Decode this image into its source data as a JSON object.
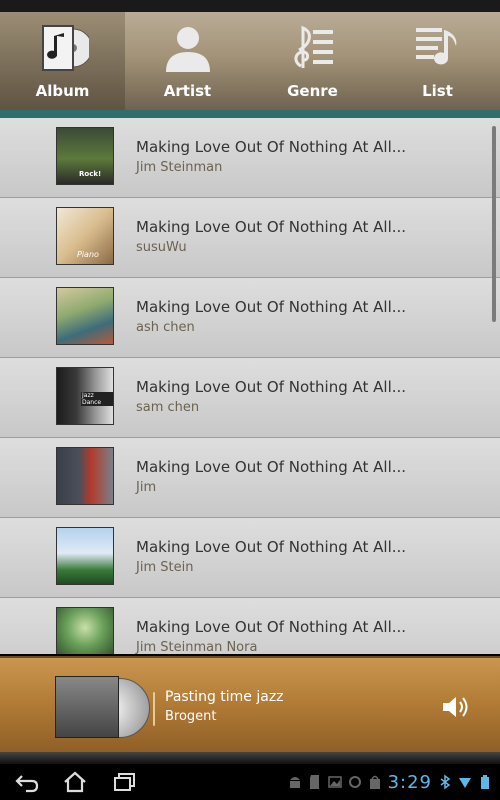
{
  "tabs": [
    {
      "label": "Album",
      "icon": "album-icon",
      "active": true
    },
    {
      "label": "Artist",
      "icon": "artist-icon",
      "active": false
    },
    {
      "label": "Genre",
      "icon": "genre-icon",
      "active": false
    },
    {
      "label": "List",
      "icon": "playlist-icon",
      "active": false
    }
  ],
  "songs": [
    {
      "title": "Making Love Out Of Nothing At All...",
      "artist": "Jim Steinman",
      "thumb_text": "Rock!",
      "colors": [
        "#2d3a2a",
        "#5c7a3a",
        "#a0324a"
      ]
    },
    {
      "title": "Making Love Out Of Nothing At All...",
      "artist": "susuWu",
      "thumb_text": "Piano",
      "colors": [
        "#e8dfc9",
        "#c9a97a",
        "#7a5a3a"
      ]
    },
    {
      "title": "Making Love Out Of Nothing At All...",
      "artist": "ash chen",
      "thumb_text": "",
      "colors": [
        "#c8b98f",
        "#7f9a6a",
        "#3a5a6a"
      ]
    },
    {
      "title": "Making Love Out Of Nothing At All...",
      "artist": "sam chen",
      "thumb_text": "Jazz Dance",
      "colors": [
        "#1c1c1c",
        "#6a6a6a",
        "#dcdcdc"
      ]
    },
    {
      "title": "Making Love Out Of Nothing At All...",
      "artist": "Jim",
      "thumb_text": "",
      "colors": [
        "#3a3f4a",
        "#b23a2a",
        "#7a7f8a"
      ]
    },
    {
      "title": "Making Love Out Of Nothing At All...",
      "artist": "Jim Stein",
      "thumb_text": "",
      "colors": [
        "#a9c9e9",
        "#3a7a3a",
        "#dfeaf5"
      ]
    },
    {
      "title": "Making Love Out Of Nothing At All...",
      "artist": "Jim Steinman Nora",
      "thumb_text": "",
      "colors": [
        "#1f3a1f",
        "#6aa05a",
        "#c9e0a9"
      ]
    }
  ],
  "now_playing": {
    "title": "Pasting time jazz",
    "artist": "Brogent"
  },
  "status_bar": {
    "time": "3:29"
  },
  "accent": "#2f6e6a"
}
